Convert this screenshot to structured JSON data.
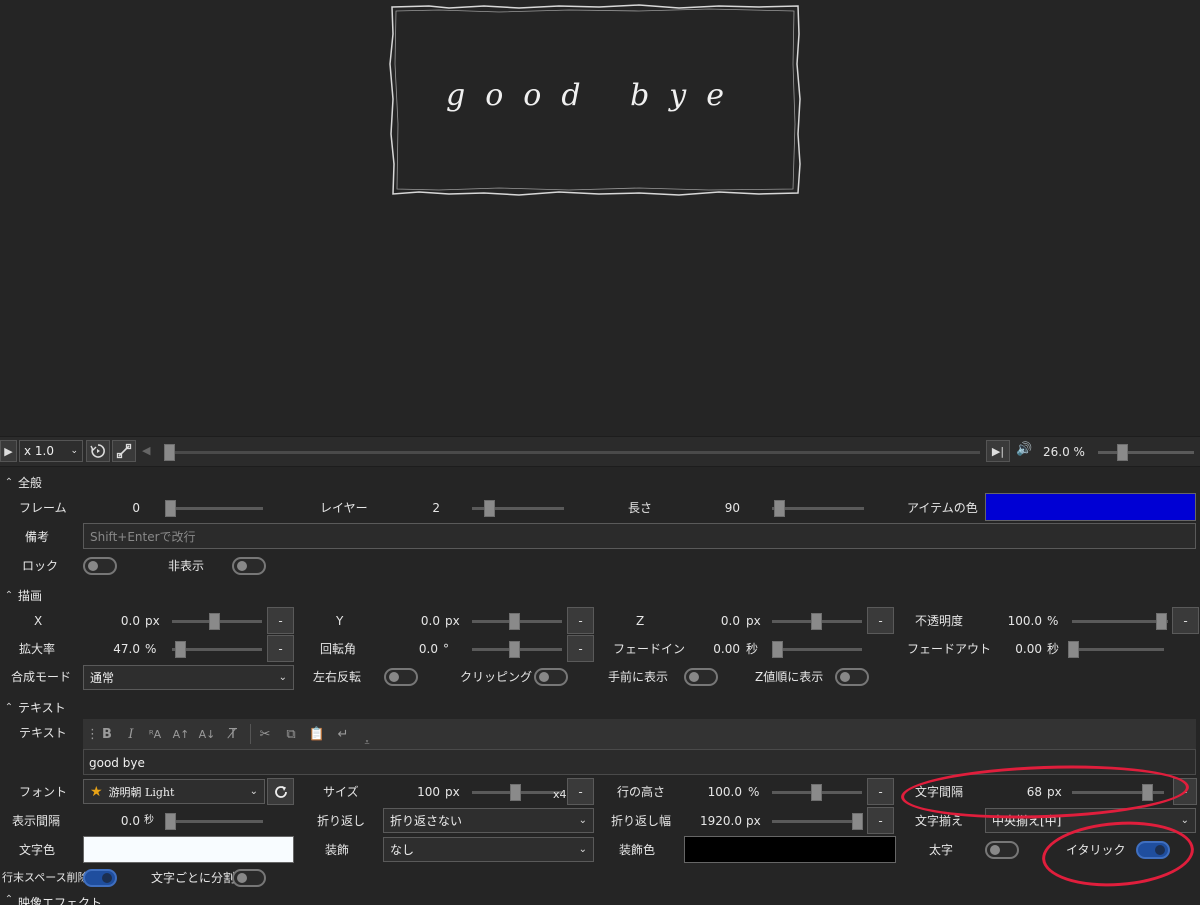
{
  "preview": {
    "text": "good bye"
  },
  "transport": {
    "speed": "x 1.0",
    "zoom": "26.0 %",
    "icons": {
      "play": "play-icon",
      "loop": "loop-icon",
      "expand": "expand-icon",
      "prev": "prev-frame-icon",
      "end": "skip-to-end-icon",
      "volume": "volume-icon"
    }
  },
  "sections": {
    "general": "全般",
    "drawing": "描画",
    "text": "テキスト",
    "effects": "映像エフェクト"
  },
  "general": {
    "frame_label": "フレーム",
    "frame_value": "0",
    "layer_label": "レイヤー",
    "layer_value": "2",
    "length_label": "長さ",
    "length_value": "90",
    "item_color_label": "アイテムの色",
    "item_color": "#0000d4",
    "memo_label": "備考",
    "memo_placeholder": "Shift+Enterで改行",
    "lock_label": "ロック",
    "hide_label": "非表示"
  },
  "drawing": {
    "x_label": "X",
    "x_value": "0.0",
    "x_unit": "px",
    "y_label": "Y",
    "y_value": "0.0",
    "y_unit": "px",
    "z_label": "Z",
    "z_value": "0.0",
    "z_unit": "px",
    "opacity_label": "不透明度",
    "opacity_value": "100.0",
    "opacity_unit": "%",
    "scale_label": "拡大率",
    "scale_value": "47.0",
    "scale_unit": "%",
    "rotation_label": "回転角",
    "rotation_value": "0.0",
    "rotation_unit": "°",
    "fadein_label": "フェードイン",
    "fadein_value": "0.00",
    "fadein_unit": "秒",
    "fadeout_label": "フェードアウト",
    "fadeout_value": "0.00",
    "fadeout_unit": "秒",
    "blend_label": "合成モード",
    "blend_value": "通常",
    "flip_label": "左右反転",
    "clipping_label": "クリッピング",
    "front_label": "手前に表示",
    "zorder_label": "Z値順に表示",
    "minus": "-"
  },
  "text": {
    "text_label": "テキスト",
    "text_value": "good bye",
    "font_label": "フォント",
    "font_value": "游明朝 Light",
    "size_label": "サイズ",
    "size_value": "100",
    "size_unit": "px",
    "size_mult": "x4",
    "line_height_label": "行の高さ",
    "line_height_value": "100.0",
    "line_height_unit": "%",
    "spacing_label": "文字間隔",
    "spacing_value": "68",
    "spacing_unit": "px",
    "interval_label": "表示間隔",
    "interval_value": "0.0",
    "interval_unit": "秒",
    "wrap_label": "折り返し",
    "wrap_value": "折り返さない",
    "wrap_width_label": "折り返し幅",
    "wrap_width_value": "1920.0",
    "wrap_width_unit": "px",
    "align_label": "文字揃え",
    "align_value": "中央揃え[中]",
    "color_label": "文字色",
    "color": "#f8fcff",
    "deco_label": "装飾",
    "deco_value": "なし",
    "deco_color_label": "装飾色",
    "deco_color": "#000000",
    "bold_label": "太字",
    "italic_label": "イタリック",
    "trim_label": "行末スペース削除",
    "split_label": "文字ごとに分割"
  },
  "annotation_color": "#e01e3c"
}
